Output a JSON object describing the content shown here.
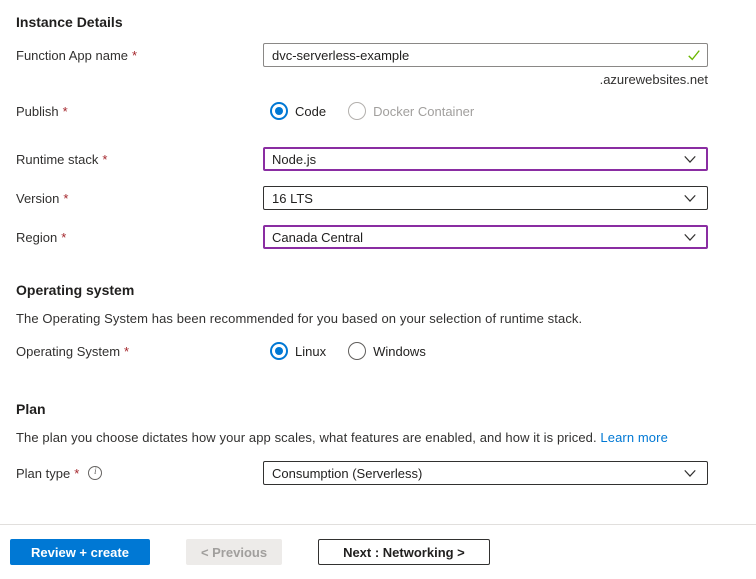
{
  "instance_details": {
    "title": "Instance Details",
    "function_app_name": {
      "label": "Function App name",
      "required_marker": "*",
      "value": "dvc-serverless-example",
      "domain_suffix": ".azurewebsites.net"
    },
    "publish": {
      "label": "Publish",
      "required_marker": "*",
      "options": [
        {
          "label": "Code",
          "selected": true,
          "disabled": false
        },
        {
          "label": "Docker Container",
          "selected": false,
          "disabled": true
        }
      ]
    },
    "runtime_stack": {
      "label": "Runtime stack",
      "required_marker": "*",
      "value": "Node.js",
      "highlighted": true
    },
    "version": {
      "label": "Version",
      "required_marker": "*",
      "value": "16 LTS",
      "highlighted": false
    },
    "region": {
      "label": "Region",
      "required_marker": "*",
      "value": "Canada Central",
      "highlighted": true
    }
  },
  "operating_system": {
    "title": "Operating system",
    "description": "The Operating System has been recommended for you based on your selection of runtime stack.",
    "field": {
      "label": "Operating System",
      "required_marker": "*",
      "options": [
        {
          "label": "Linux",
          "selected": true,
          "disabled": false
        },
        {
          "label": "Windows",
          "selected": false,
          "disabled": false
        }
      ]
    }
  },
  "plan": {
    "title": "Plan",
    "description": "The plan you choose dictates how your app scales, what features are enabled, and how it is priced.",
    "learn_more_label": "Learn more",
    "plan_type": {
      "label": "Plan type",
      "required_marker": "*",
      "value": "Consumption (Serverless)",
      "highlighted": false
    }
  },
  "footer": {
    "review_create_label": "Review + create",
    "previous_label": "< Previous",
    "next_label": "Next : Networking >"
  },
  "colors": {
    "primary_blue": "#0078d4",
    "highlight_purple": "#8a2da2",
    "success_green": "#6bb700",
    "required_red": "#a4262c"
  }
}
